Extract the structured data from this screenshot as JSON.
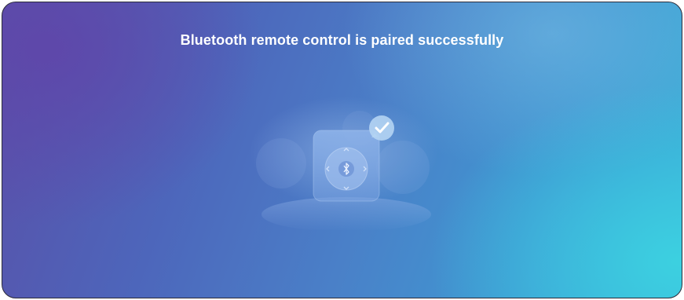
{
  "window": {
    "title": "Bluetooth remote control is paired successfully"
  },
  "icons": {
    "illustration": "remote-paired-illustration",
    "check": "check-icon",
    "bluetooth": "bluetooth-icon"
  },
  "colors": {
    "background_left": "#5a4fa8",
    "background_right": "#3bb4d8",
    "text": "#ffffff",
    "check_badge": "#a9cff0"
  }
}
